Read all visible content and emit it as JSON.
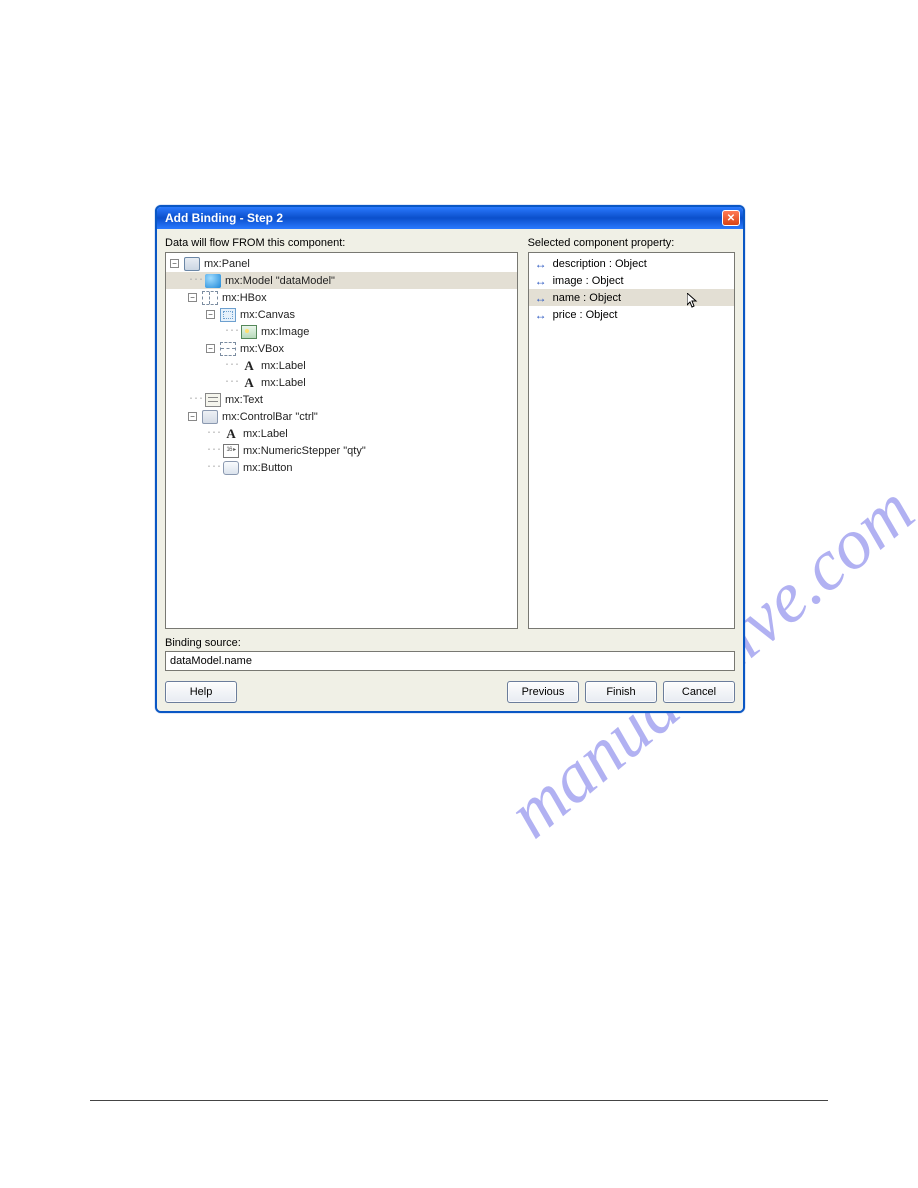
{
  "watermark": "manualshive.com",
  "dialog": {
    "title": "Add Binding - Step 2",
    "leftLabel": "Data will flow FROM this component:",
    "rightLabel": "Selected component property:",
    "bindingSourceLabel": "Binding source:",
    "bindingSourceValue": "dataModel.name"
  },
  "tree": [
    {
      "depth": 0,
      "exp": "-",
      "icon": "panel-i",
      "label": "mx:Panel"
    },
    {
      "depth": 1,
      "exp": "",
      "icon": "model-i",
      "label": "mx:Model \"dataModel\"",
      "sel": true
    },
    {
      "depth": 1,
      "exp": "-",
      "icon": "hbox-i",
      "label": "mx:HBox"
    },
    {
      "depth": 2,
      "exp": "-",
      "icon": "canvas-i",
      "label": "mx:Canvas"
    },
    {
      "depth": 3,
      "exp": "",
      "icon": "image-i",
      "label": "mx:Image"
    },
    {
      "depth": 2,
      "exp": "-",
      "icon": "vbox-i",
      "label": "mx:VBox"
    },
    {
      "depth": 3,
      "exp": "",
      "icon": "label-i",
      "label": "mx:Label"
    },
    {
      "depth": 3,
      "exp": "",
      "icon": "label-i",
      "label": "mx:Label"
    },
    {
      "depth": 1,
      "exp": "",
      "icon": "text-i",
      "label": "mx:Text"
    },
    {
      "depth": 1,
      "exp": "-",
      "icon": "ctrlbar-i",
      "label": "mx:ControlBar \"ctrl\""
    },
    {
      "depth": 2,
      "exp": "",
      "icon": "label-i",
      "label": "mx:Label"
    },
    {
      "depth": 2,
      "exp": "",
      "icon": "stepper-i",
      "label": "mx:NumericStepper \"qty\""
    },
    {
      "depth": 2,
      "exp": "",
      "icon": "button-i",
      "label": "mx:Button"
    }
  ],
  "props": [
    {
      "label": "description : Object"
    },
    {
      "label": "image : Object"
    },
    {
      "label": "name : Object",
      "sel": true,
      "cursor": true
    },
    {
      "label": "price : Object"
    }
  ],
  "buttons": {
    "help": "Help",
    "previous": "Previous",
    "finish": "Finish",
    "cancel": "Cancel"
  }
}
